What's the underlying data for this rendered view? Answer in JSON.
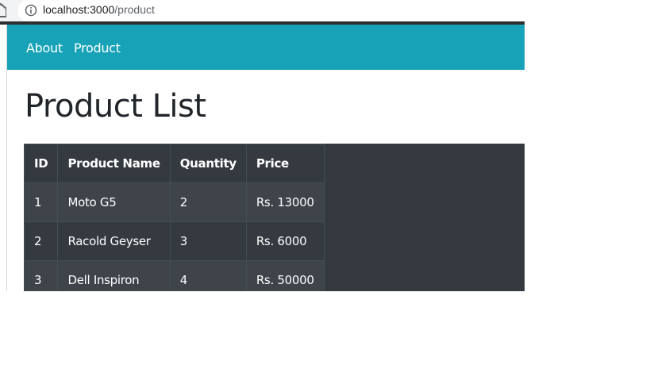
{
  "browser": {
    "url_host": "localhost:3000",
    "url_path": "/product"
  },
  "navbar": {
    "links": [
      {
        "label": "About"
      },
      {
        "label": "Product"
      }
    ]
  },
  "page": {
    "title": "Product List"
  },
  "table": {
    "headers": [
      "ID",
      "Product Name",
      "Quantity",
      "Price"
    ],
    "rows": [
      [
        "1",
        "Moto G5",
        "2",
        "Rs. 13000"
      ],
      [
        "2",
        "Racold Geyser",
        "3",
        "Rs. 6000"
      ],
      [
        "3",
        "Dell Inspiron",
        "4",
        "Rs. 50000"
      ]
    ]
  },
  "colors": {
    "navbar_bg": "#17a2b8",
    "table_dark": "#343a40",
    "table_stripe": "#3e444a"
  }
}
